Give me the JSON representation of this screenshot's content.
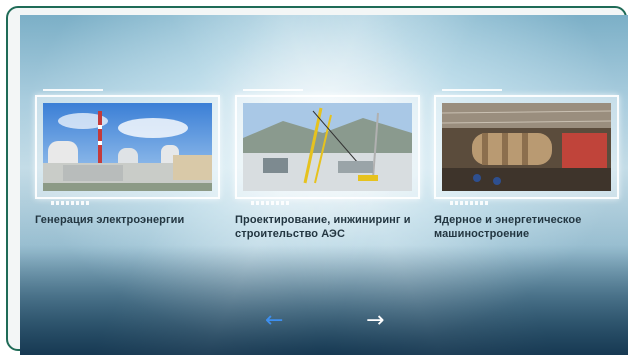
{
  "cards": [
    {
      "title": "Генерация электроэнергии",
      "image": "power-plant-photo"
    },
    {
      "title": "Проектирование, инжиниринг и строительство АЭС",
      "image": "construction-site-photo"
    },
    {
      "title": "Ядерное и энергетическое машиностроение",
      "image": "factory-photo"
    }
  ],
  "nav": {
    "prev_icon": "arrow-left-icon",
    "next_icon": "arrow-right-icon",
    "prev_glyph": "←",
    "next_glyph": "→",
    "prev_color": "#3d8ff0",
    "next_color": "#ffffff"
  },
  "colors": {
    "frame_border": "#1f6b57",
    "caption_text": "#233641"
  }
}
